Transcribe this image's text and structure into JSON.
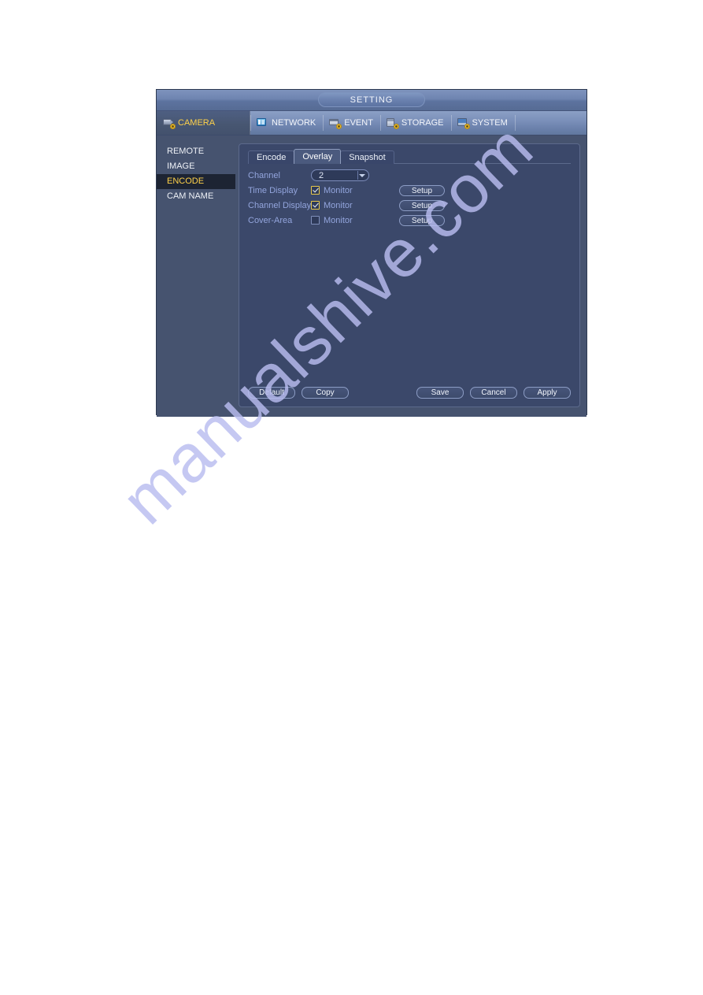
{
  "watermark": {
    "text": "manualshive.com"
  },
  "window": {
    "title": "SETTING",
    "main_tabs": [
      {
        "label": "CAMERA",
        "icon": "camera-icon",
        "active": true
      },
      {
        "label": "NETWORK",
        "icon": "network-icon",
        "active": false
      },
      {
        "label": "EVENT",
        "icon": "event-icon",
        "active": false
      },
      {
        "label": "STORAGE",
        "icon": "storage-icon",
        "active": false
      },
      {
        "label": "SYSTEM",
        "icon": "system-icon",
        "active": false
      }
    ],
    "sidebar": {
      "items": [
        {
          "label": "REMOTE",
          "active": false
        },
        {
          "label": "IMAGE",
          "active": false
        },
        {
          "label": "ENCODE",
          "active": true
        },
        {
          "label": "CAM NAME",
          "active": false
        }
      ]
    },
    "sub_tabs": [
      {
        "label": "Encode",
        "active": false
      },
      {
        "label": "Overlay",
        "active": true
      },
      {
        "label": "Snapshot",
        "active": false
      }
    ],
    "form": {
      "channel": {
        "label": "Channel",
        "value": "2",
        "arrow_icon": "chevron-down-icon"
      },
      "rows": [
        {
          "label": "Time Display",
          "checkbox_label": "Monitor",
          "checked": true,
          "button": "Setup"
        },
        {
          "label": "Channel Display",
          "checkbox_label": "Monitor",
          "checked": true,
          "button": "Setup"
        },
        {
          "label": "Cover-Area",
          "checkbox_label": "Monitor",
          "checked": false,
          "button": "Setup"
        }
      ]
    },
    "footer": {
      "default_label": "Default",
      "copy_label": "Copy",
      "save_label": "Save",
      "cancel_label": "Cancel",
      "apply_label": "Apply"
    }
  },
  "colors": {
    "accent_yellow": "#ffd24a",
    "label_blue": "#93a5dd",
    "panel_bg": "#3b486a",
    "window_bg": "#46536f",
    "watermark": "#b9bdf0"
  }
}
